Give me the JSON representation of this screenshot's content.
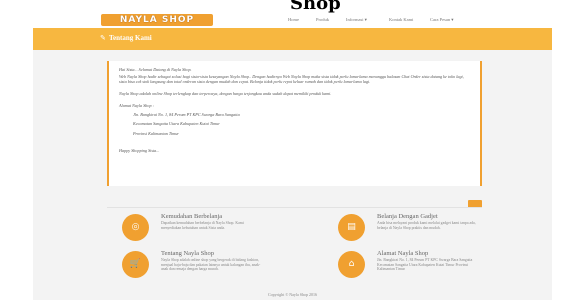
{
  "caption": "Shop",
  "header": {
    "logo_text": "NAYLA SHOP",
    "nav": [
      "Home",
      "Produk",
      "Informasi ▾",
      "Kontak Kami",
      "Cara Pesan ▾"
    ]
  },
  "banner": {
    "icon": "edit-icon",
    "title": "Tentang Kami"
  },
  "content": {
    "greeting": "Hai Sista... Selamat Datang di Nayla Shop.",
    "para1": "Web Nayla Shop hadir sebagai solusi bagi sista-sista kesayangan Nayla Shop.. Dengan hadirnya Web Nayla Shop maka sista tidak perlu lama-lama menunggu balasan Chat Order sista datang ke toko lagi, sista bisa cek stok langsung dan total orderan sista dengan mudah dan cepat. Belanja tidak perlu repot keluar rumah dan tidak perlu lama-lama lagi.",
    "para2": "Nayla Shop adalah online Shop terlengkap dan terpercaya, dengan harga terjangkau anda sudah dapat memiliki produk kami.",
    "address_label": "Alamat Nayla Shop :",
    "address_lines": [
      "Jln. Bangkirai No. 1, 84 Perum PT KPC Swarga Bara Sangatta",
      "Kecamatan Sangatta Utara Kabupaten Kutai Timur",
      "Provinsi Kalimantan Timur"
    ],
    "closing": "Happy Shopping Sista..."
  },
  "features": [
    {
      "icon": "target-icon",
      "title": "Kemudahan Berbelanja",
      "desc": "Dapatkan kemudahan berbelanja di Nayla Shop. Kami menyediakan kebutuhan untuk Sista anda."
    },
    {
      "icon": "document-icon",
      "title": "Belanja Dengan Gadjet",
      "desc": "Anda bisa melayani produk kami melalui gadget kami tanpa ada, belanja di Nayla Shop praktis dan mudah."
    },
    {
      "icon": "cart-icon",
      "title": "Tentang Nayla Shop",
      "desc": "Nayla Shop adalah online shop yang bergerak di bidang fashion, menjual baju-baju dan pakaian lainnya untuk kalangan ibu, anak-anak dan remaja dengan harga murah."
    },
    {
      "icon": "home-icon",
      "title": "Alamat Nayla Shop",
      "desc": "Jln. Bangkirai No. 1, 84 Perum PT KPC Swarga Bara Sangatta Kecamatan Sangatta Utara Kabupaten Kutai Timur Provinsi Kalimantan Timur"
    }
  ],
  "footer": {
    "copyright": "Copyright © Nayla Shop 2016"
  },
  "colors": {
    "accent": "#f0a030",
    "banner": "#f7b740",
    "background": "#f3f3f3"
  }
}
